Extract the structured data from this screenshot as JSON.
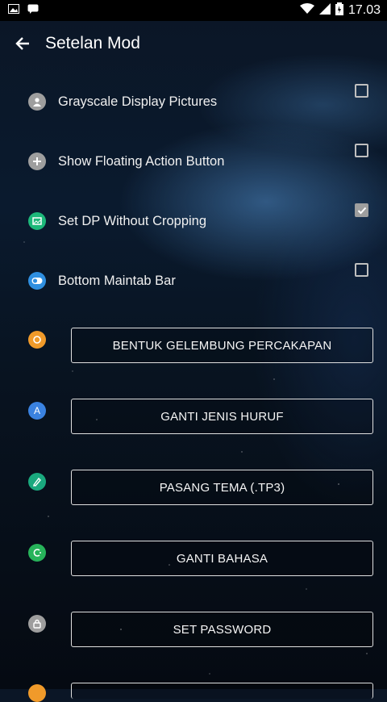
{
  "status_bar": {
    "time": "17.03"
  },
  "app_bar": {
    "title": "Setelan Mod"
  },
  "toggles": [
    {
      "label": "Grayscale Display Pictures",
      "checked": false,
      "icon": "person-icon",
      "color": "#9e9e9e"
    },
    {
      "label": "Show Floating Action Button",
      "checked": false,
      "icon": "plus-icon",
      "color": "#9e9e9e"
    },
    {
      "label": "Set DP Without Cropping",
      "checked": true,
      "icon": "image-icon",
      "color": "#1db87a"
    },
    {
      "label": "Bottom Maintab Bar",
      "checked": false,
      "icon": "toggle-icon",
      "color": "#2f8fe0"
    }
  ],
  "buttons": [
    {
      "label": "BENTUK GELEMBUNG PERCAKAPAN",
      "icon": "bubble-icon",
      "color": "#f09a2a"
    },
    {
      "label": "GANTI JENIS HURUF",
      "icon": "font-icon",
      "color": "#3a82e0"
    },
    {
      "label": "PASANG TEMA (.TP3)",
      "icon": "theme-icon",
      "color": "#1aa97e"
    },
    {
      "label": "GANTI BAHASA",
      "icon": "language-icon",
      "color": "#27b35a"
    },
    {
      "label": "SET PASSWORD",
      "icon": "lock-icon",
      "color": "#9e9e9e"
    }
  ]
}
